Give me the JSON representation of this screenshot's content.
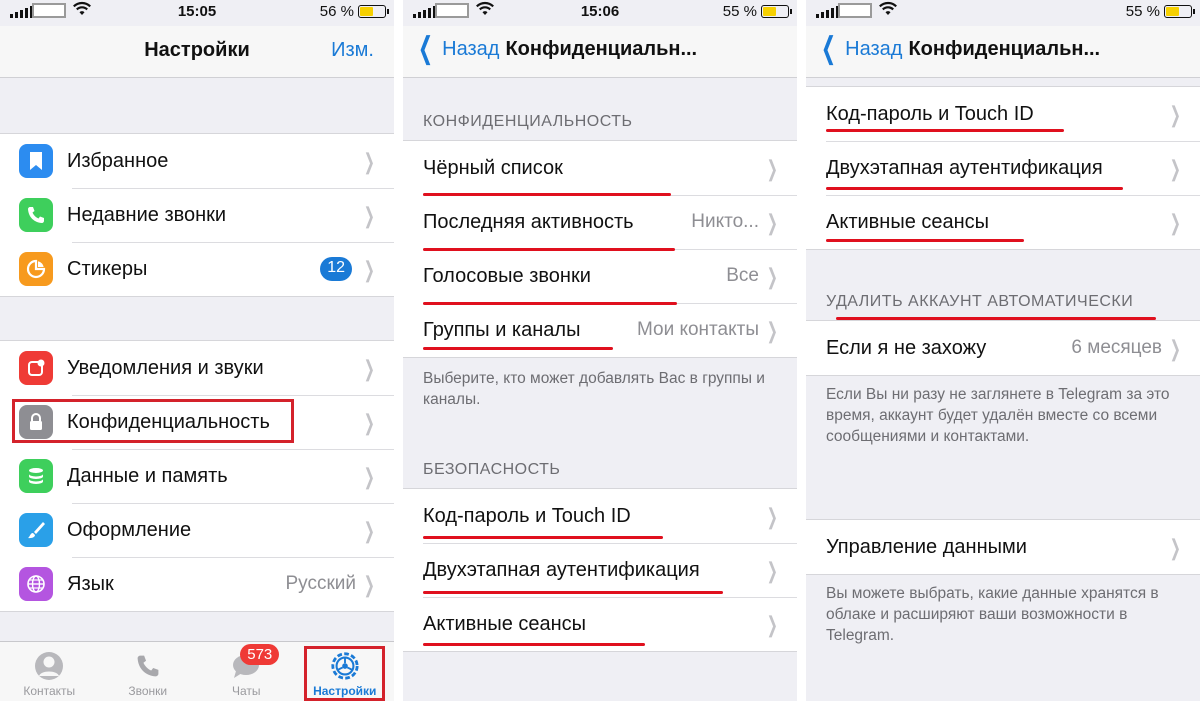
{
  "screen1": {
    "status": {
      "time": "15:05",
      "battery_percent": "56 %",
      "battery_level": 0.56
    },
    "nav": {
      "title": "Настройки",
      "edit": "Изм."
    },
    "group1": [
      {
        "label": "Избранное",
        "icon": "bookmark-icon",
        "color": "#2c8cf0"
      },
      {
        "label": "Недавние звонки",
        "icon": "phone-icon",
        "color": "#3ecf5c"
      },
      {
        "label": "Стикеры",
        "icon": "sticker-icon",
        "color": "#f79a1e",
        "badge": "12"
      }
    ],
    "group2": [
      {
        "label": "Уведомления и звуки",
        "icon": "notification-icon",
        "color": "#ef3b36"
      },
      {
        "label": "Конфиденциальность",
        "icon": "lock-icon",
        "color": "#8e8e93"
      },
      {
        "label": "Данные и память",
        "icon": "database-icon",
        "color": "#3ecf5c"
      },
      {
        "label": "Оформление",
        "icon": "brush-icon",
        "color": "#2aa0e8"
      },
      {
        "label": "Язык",
        "icon": "globe-icon",
        "color": "#b455e0",
        "value": "Русский"
      }
    ],
    "tabs": [
      {
        "label": "Контакты",
        "icon": "person-icon"
      },
      {
        "label": "Звонки",
        "icon": "phone-icon"
      },
      {
        "label": "Чаты",
        "icon": "chat-icon",
        "badge": "573"
      },
      {
        "label": "Настройки",
        "icon": "gear-icon",
        "active": true
      }
    ]
  },
  "screen2": {
    "status": {
      "time": "15:06",
      "battery_percent": "55 %",
      "battery_level": 0.55
    },
    "nav": {
      "back": "Назад",
      "title": "Конфиденциальн..."
    },
    "privacy_header": "КОНФИДЕНЦИАЛЬНОСТЬ",
    "privacy_rows": [
      {
        "label": "Чёрный список",
        "value": ""
      },
      {
        "label": "Последняя активность",
        "value": "Никто..."
      },
      {
        "label": "Голосовые звонки",
        "value": "Все"
      },
      {
        "label": "Группы и каналы",
        "value": "Мои контакты"
      }
    ],
    "privacy_footer": "Выберите, кто может добавлять Вас в группы и каналы.",
    "security_header": "БЕЗОПАСНОСТЬ",
    "security_rows": [
      {
        "label": "Код-пароль и Touch ID"
      },
      {
        "label": "Двухэтапная аутентификация"
      },
      {
        "label": "Активные сеансы"
      }
    ]
  },
  "screen3": {
    "status": {
      "battery_percent": "55 %",
      "battery_level": 0.55
    },
    "nav": {
      "back": "Назад",
      "title": "Конфиденциальн..."
    },
    "security_rows": [
      {
        "label": "Код-пароль и Touch ID"
      },
      {
        "label": "Двухэтапная аутентификация"
      },
      {
        "label": "Активные сеансы"
      }
    ],
    "delete_header": "УДАЛИТЬ АККАУНТ АВТОМАТИЧЕСКИ",
    "delete_row": {
      "label": "Если я не захожу",
      "value": "6 месяцев"
    },
    "delete_footer": "Если Вы ни разу не заглянете в Telegram за это время, аккаунт будет удалён вместе со всеми сообщениями и контактами.",
    "data_row": {
      "label": "Управление данными"
    },
    "data_footer": "Вы можете выбрать, какие данные хранятся в облаке и расширяют ваши возможности в Telegram."
  },
  "colors": {
    "accent": "#1a7ad6",
    "highlight": "#e0101e"
  }
}
